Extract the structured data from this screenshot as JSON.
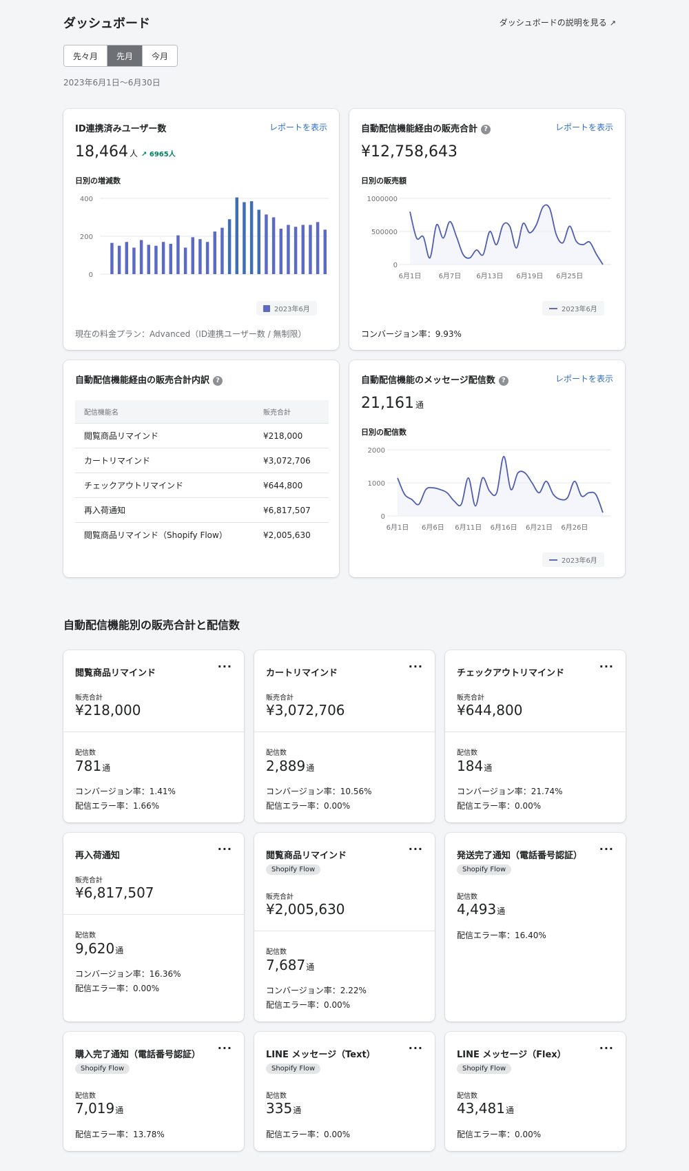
{
  "header": {
    "title": "ダッシュボード",
    "help_link": "ダッシュボードの説明を見る",
    "periods": [
      "先々月",
      "先月",
      "今月"
    ],
    "active_period": "先月",
    "date_range": "2023年6月1日〜6月30日"
  },
  "users_card": {
    "title": "ID連携済みユーザー数",
    "report_link": "レポートを表示",
    "value": "18,464",
    "unit": "人",
    "delta": "6965人",
    "sub_label": "日別の増減数",
    "legend": "2023年6月",
    "plan_text": "現在の料金プラン：Advanced（ID連携ユーザー数 / 無制限）"
  },
  "sales_card": {
    "title": "自動配信機能経由の販売合計",
    "report_link": "レポートを表示",
    "value": "¥12,758,643",
    "sub_label": "日別の販売額",
    "legend": "2023年6月",
    "conversion": "コンバージョン率：9.93%"
  },
  "breakdown_card": {
    "title": "自動配信機能経由の販売合計内訳",
    "headers": [
      "配信機能名",
      "販売合計"
    ],
    "rows": [
      [
        "閲覧商品リマインド",
        "¥218,000"
      ],
      [
        "カートリマインド",
        "¥3,072,706"
      ],
      [
        "チェックアウトリマインド",
        "¥644,800"
      ],
      [
        "再入荷通知",
        "¥6,817,507"
      ],
      [
        "閲覧商品リマインド（Shopify Flow）",
        "¥2,005,630"
      ]
    ]
  },
  "messages_card": {
    "title": "自動配信機能のメッセージ配信数",
    "report_link": "レポートを表示",
    "value": "21,161",
    "unit": "通",
    "sub_label": "日別の配信数",
    "legend": "2023年6月"
  },
  "section_title": "自動配信機能別の販売合計と配信数",
  "features": [
    {
      "name": "閲覧商品リマインド",
      "sales_label": "販売合計",
      "sales": "¥218,000",
      "count_label": "配信数",
      "count": "781",
      "unit": "通",
      "conversion": "コンバージョン率：1.41%",
      "error": "配信エラー率：1.66%"
    },
    {
      "name": "カートリマインド",
      "sales_label": "販売合計",
      "sales": "¥3,072,706",
      "count_label": "配信数",
      "count": "2,889",
      "unit": "通",
      "conversion": "コンバージョン率：10.56%",
      "error": "配信エラー率：0.00%"
    },
    {
      "name": "チェックアウトリマインド",
      "sales_label": "販売合計",
      "sales": "¥644,800",
      "count_label": "配信数",
      "count": "184",
      "unit": "通",
      "conversion": "コンバージョン率：21.74%",
      "error": "配信エラー率：0.00%"
    },
    {
      "name": "再入荷通知",
      "sales_label": "販売合計",
      "sales": "¥6,817,507",
      "count_label": "配信数",
      "count": "9,620",
      "unit": "通",
      "conversion": "コンバージョン率：16.36%",
      "error": "配信エラー率：0.00%"
    },
    {
      "name": "閲覧商品リマインド",
      "tag": "Shopify Flow",
      "sales_label": "販売合計",
      "sales": "¥2,005,630",
      "count_label": "配信数",
      "count": "7,687",
      "unit": "通",
      "conversion": "コンバージョン率：2.22%",
      "error": "配信エラー率：0.00%"
    },
    {
      "name": "発送完了通知（電話番号認証）",
      "tag": "Shopify Flow",
      "count_label": "配信数",
      "count": "4,493",
      "unit": "通",
      "error": "配信エラー率：16.40%"
    },
    {
      "name": "購入完了通知（電話番号認証）",
      "tag": "Shopify Flow",
      "count_label": "配信数",
      "count": "7,019",
      "unit": "通",
      "error": "配信エラー率：13.78%"
    },
    {
      "name": "LINE メッセージ（Text）",
      "tag": "Shopify Flow",
      "count_label": "配信数",
      "count": "335",
      "unit": "通",
      "error": "配信エラー率：0.00%"
    },
    {
      "name": "LINE メッセージ（Flex）",
      "tag": "Shopify Flow",
      "count_label": "配信数",
      "count": "43,481",
      "unit": "通",
      "error": "配信エラー率：0.00%"
    }
  ],
  "colors": {
    "bar": "#5c6ac4",
    "bar_alt": "#3f6eb5",
    "line": "#4f5db0",
    "link": "#2c6ecb",
    "delta": "#008060"
  },
  "chart_data": [
    {
      "type": "bar",
      "x": [
        "6/1",
        "6/2",
        "6/3",
        "6/4",
        "6/5",
        "6/6",
        "6/7",
        "6/8",
        "6/9",
        "6/10",
        "6/11",
        "6/12",
        "6/13",
        "6/14",
        "6/15",
        "6/16",
        "6/17",
        "6/18",
        "6/19",
        "6/20",
        "6/21",
        "6/22",
        "6/23",
        "6/24",
        "6/25",
        "6/26",
        "6/27",
        "6/28",
        "6/29",
        "6/30"
      ],
      "values": [
        165,
        150,
        170,
        140,
        180,
        155,
        150,
        170,
        160,
        205,
        140,
        195,
        185,
        170,
        225,
        245,
        290,
        405,
        380,
        385,
        340,
        315,
        300,
        240,
        260,
        250,
        260,
        260,
        275,
        235
      ],
      "ylim": [
        0,
        400
      ],
      "yticks": [
        0,
        200,
        400
      ],
      "legend": "2023年6月"
    },
    {
      "type": "line",
      "x": [
        1,
        2,
        3,
        4,
        5,
        6,
        7,
        8,
        9,
        10,
        11,
        12,
        13,
        14,
        15,
        16,
        17,
        18,
        19,
        20,
        21,
        22,
        23,
        24,
        25,
        26,
        27,
        28,
        29,
        30
      ],
      "values": [
        800000,
        400000,
        420000,
        100000,
        600000,
        400000,
        650000,
        420000,
        150000,
        100000,
        220000,
        150000,
        500000,
        300000,
        600000,
        580000,
        250000,
        620000,
        480000,
        600000,
        870000,
        850000,
        450000,
        330000,
        580000,
        350000,
        300000,
        340000,
        160000,
        0
      ],
      "ylim": [
        0,
        1000000
      ],
      "yticks": [
        0,
        500000,
        1000000
      ],
      "xtick_labels": [
        "6月1日",
        "6月7日",
        "6月13日",
        "6月19日",
        "6月25日"
      ],
      "xtick_days": [
        1,
        7,
        13,
        19,
        25
      ],
      "legend": "2023年6月"
    },
    {
      "type": "line",
      "x": [
        1,
        2,
        3,
        4,
        5,
        6,
        7,
        8,
        9,
        10,
        11,
        12,
        13,
        14,
        15,
        16,
        17,
        18,
        19,
        20,
        21,
        22,
        23,
        24,
        25,
        26,
        27,
        28,
        29,
        30
      ],
      "values": [
        1150,
        650,
        500,
        350,
        800,
        850,
        800,
        700,
        450,
        350,
        1150,
        300,
        1150,
        750,
        700,
        1800,
        800,
        1300,
        1300,
        1000,
        700,
        1050,
        650,
        500,
        550,
        1050,
        600,
        700,
        650,
        100
      ],
      "ylim": [
        0,
        2000
      ],
      "yticks": [
        0,
        1000,
        2000
      ],
      "xtick_labels": [
        "6月1日",
        "6月6日",
        "6月11日",
        "6月16日",
        "6月21日",
        "6月26日"
      ],
      "xtick_days": [
        1,
        6,
        11,
        16,
        21,
        26
      ],
      "legend": "2023年6月"
    }
  ]
}
